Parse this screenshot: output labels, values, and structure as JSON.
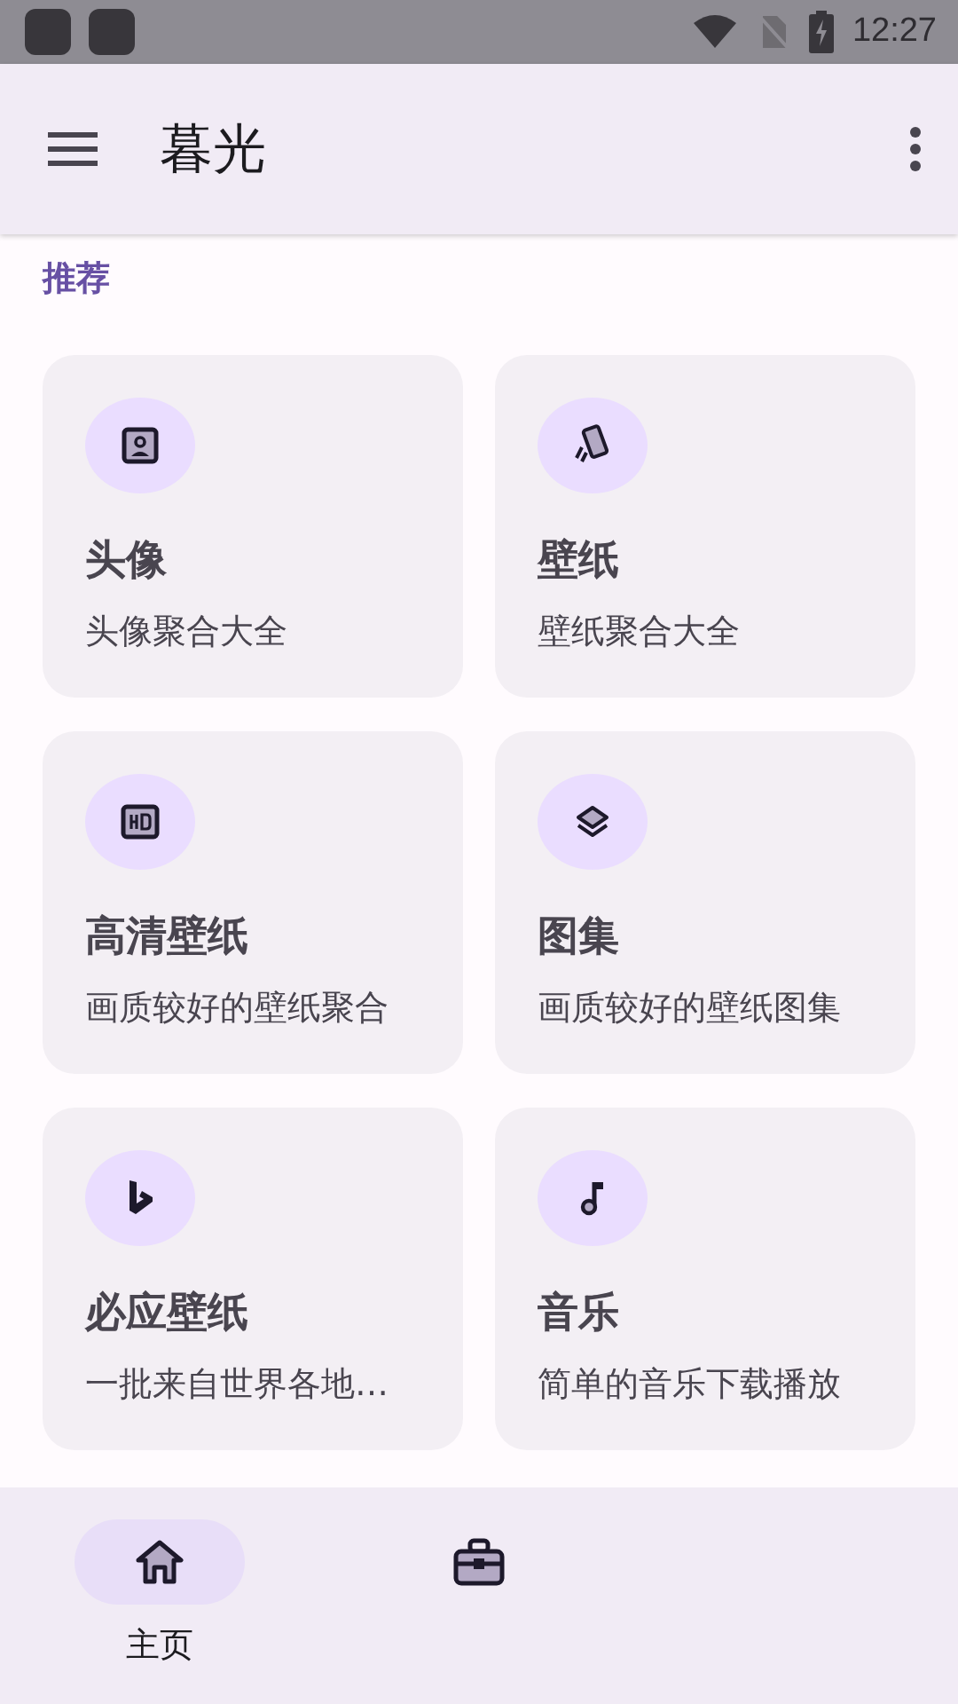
{
  "status_bar": {
    "time": "12:27"
  },
  "app_bar": {
    "title": "暮光"
  },
  "section": {
    "title": "推荐"
  },
  "cards": [
    {
      "kind": "portrait",
      "title": "头像",
      "subtitle": "头像聚合大全"
    },
    {
      "kind": "phone",
      "title": "壁纸",
      "subtitle": "壁纸聚合大全"
    },
    {
      "kind": "hd",
      "title": "高清壁纸",
      "subtitle": "画质较好的壁纸聚合"
    },
    {
      "kind": "layers",
      "title": "图集",
      "subtitle": "画质较好的壁纸图集"
    },
    {
      "kind": "bing",
      "title": "必应壁纸",
      "subtitle": "一批来自世界各地…"
    },
    {
      "kind": "music",
      "title": "音乐",
      "subtitle": "简单的音乐下载播放"
    }
  ],
  "bottom_nav": [
    {
      "kind": "home",
      "label": "主页",
      "selected": true
    },
    {
      "kind": "briefcase",
      "selected": false
    }
  ]
}
